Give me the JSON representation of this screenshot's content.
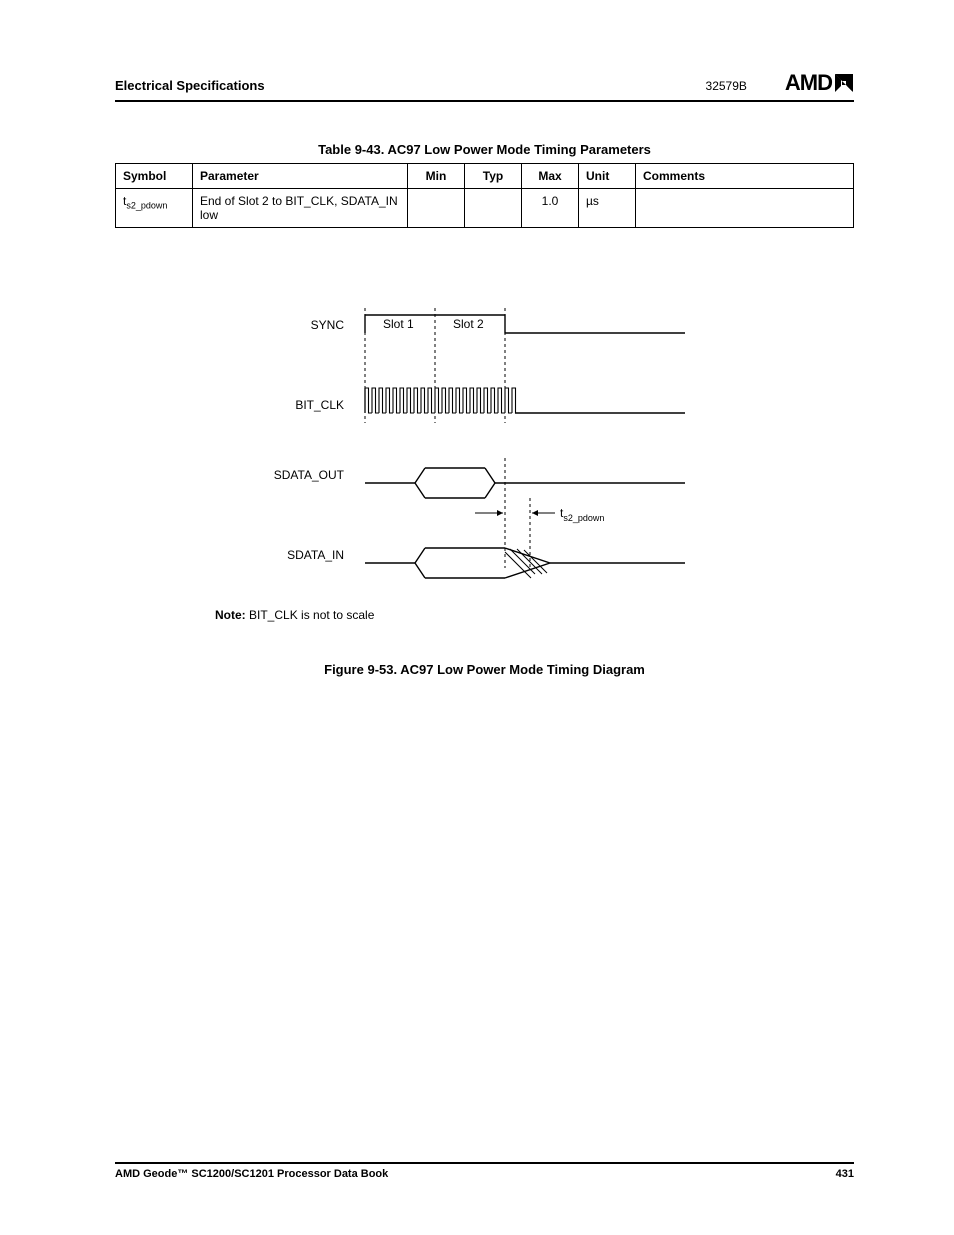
{
  "header": {
    "section": "Electrical Specifications",
    "docnum": "32579B",
    "logo_text": "AMD"
  },
  "table": {
    "caption": "Table 9-43.  AC97 Low Power Mode Timing Parameters",
    "headers": {
      "symbol": "Symbol",
      "parameter": "Parameter",
      "min": "Min",
      "typ": "Typ",
      "max": "Max",
      "unit": "Unit",
      "comments": "Comments"
    },
    "row": {
      "symbol_prefix": "t",
      "symbol_sub": "s2_pdown",
      "parameter": "End of Slot 2 to BIT_CLK, SDATA_IN low",
      "min": "",
      "typ": "",
      "max": "1.0",
      "unit": "µs",
      "comments": ""
    }
  },
  "diagram": {
    "signals": {
      "sync": "SYNC",
      "bit_clk": "BIT_CLK",
      "sdata_out": "SDATA_OUT",
      "sdata_in": "SDATA_IN"
    },
    "slot1": "Slot 1",
    "slot2": "Slot 2",
    "marker_prefix": "t",
    "marker_sub": "s2_pdown"
  },
  "note": {
    "label": "Note:",
    "text": " BIT_CLK is not to scale"
  },
  "figure_caption": "Figure 9-53.  AC97 Low Power Mode Timing Diagram",
  "footer": {
    "book": "AMD Geode™ SC1200/SC1201 Processor Data Book",
    "page": "431"
  }
}
